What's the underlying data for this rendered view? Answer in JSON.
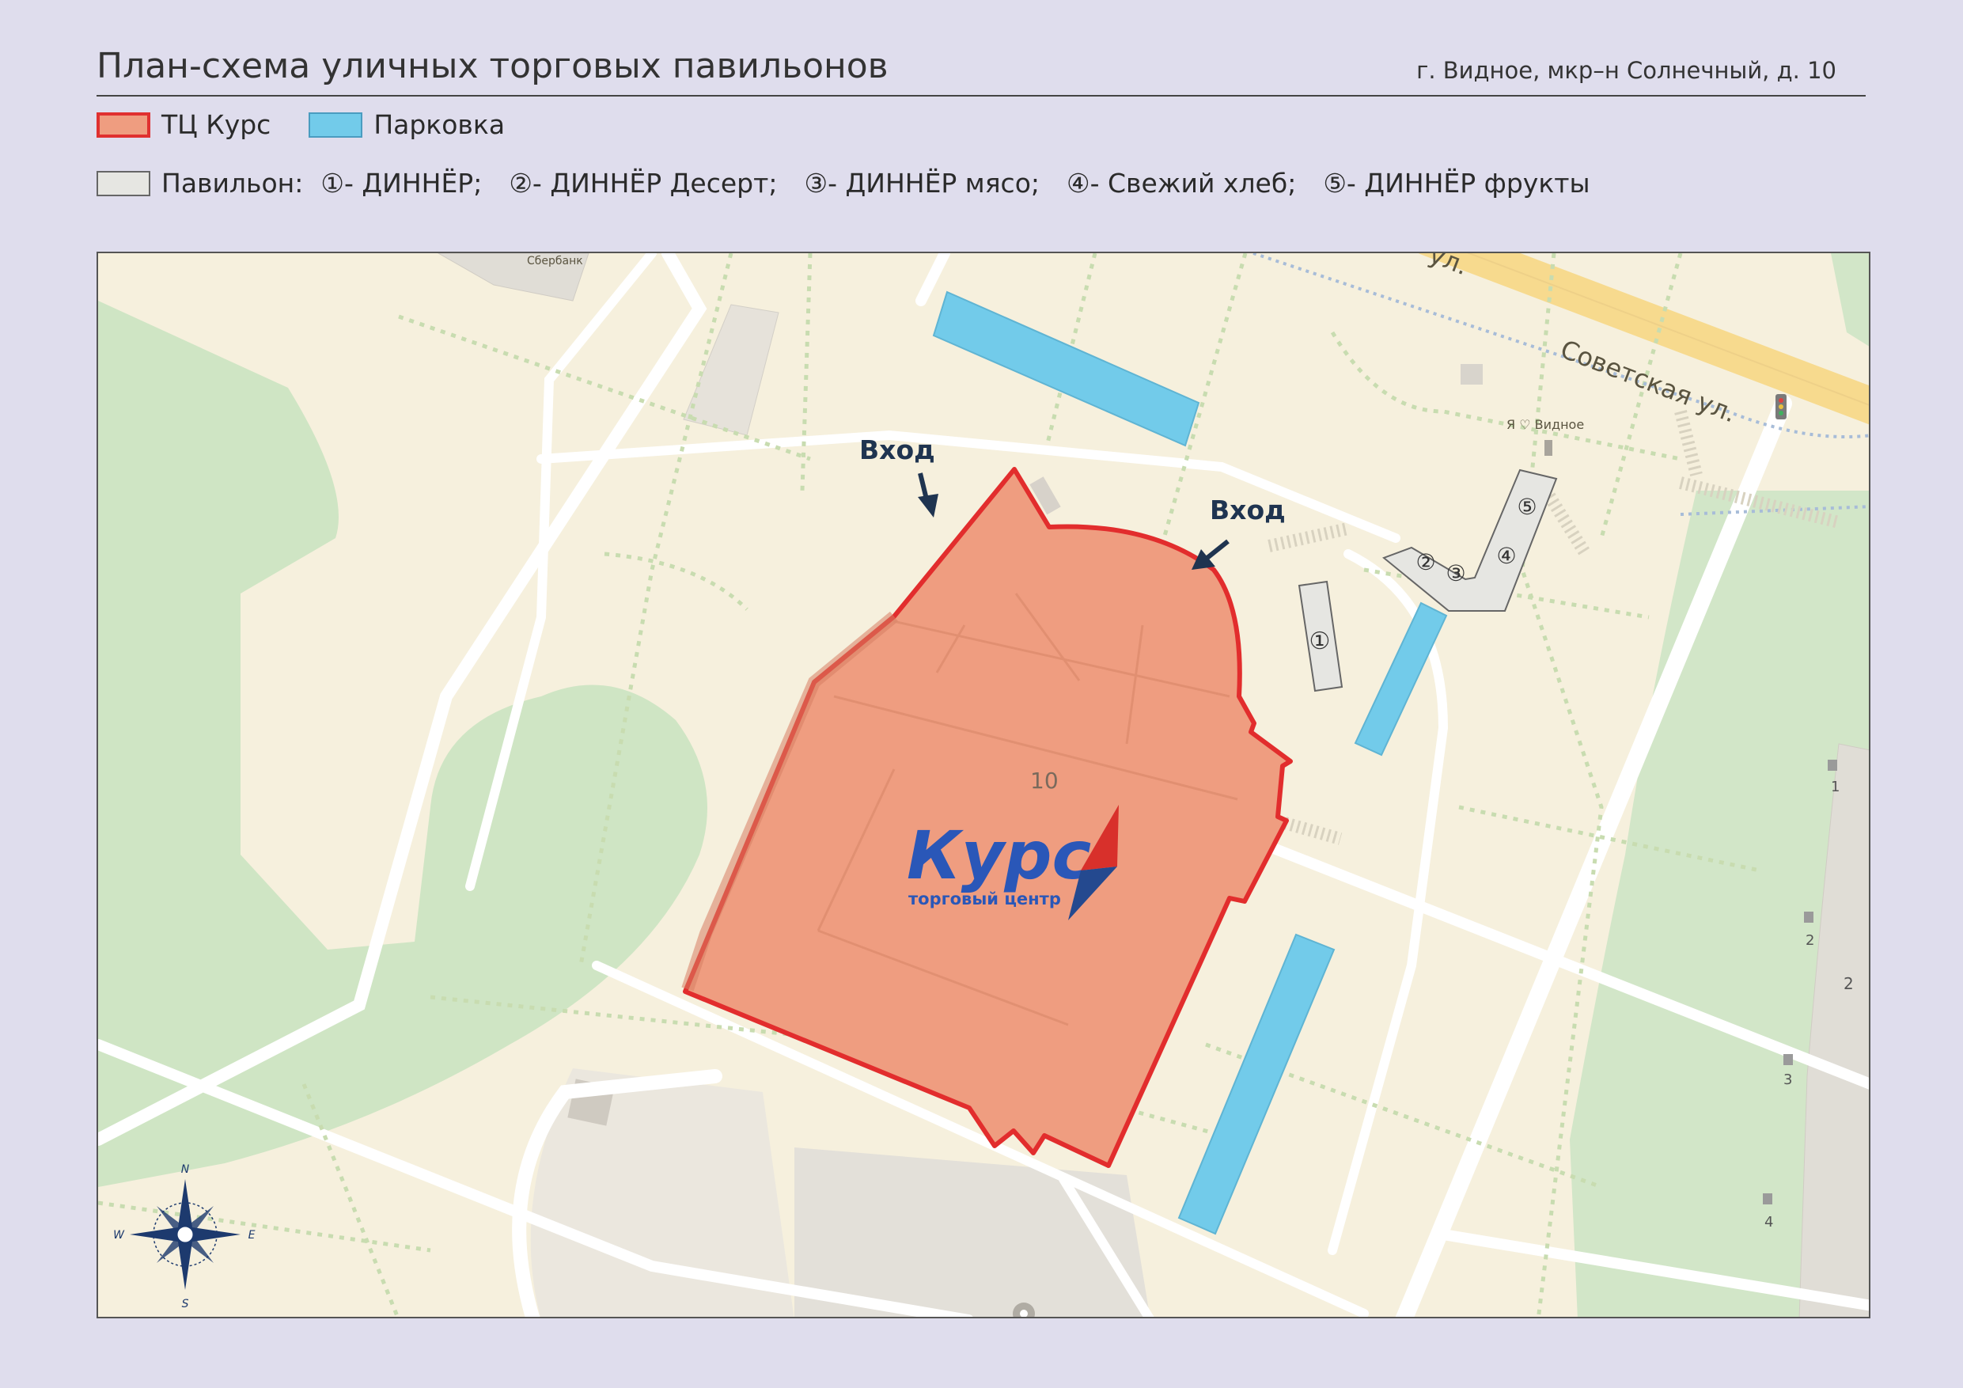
{
  "header": {
    "title": "План-схема уличных торговых павильонов",
    "address": "г. Видное, мкр–н Солнечный, д. 10"
  },
  "legend": {
    "mall_label": "ТЦ Курс",
    "parking_label": "Парковка",
    "pavilion_label": "Павильон:",
    "pavilions": [
      {
        "num": "①",
        "name": "- ДИННЁР;"
      },
      {
        "num": "②",
        "name": "-  ДИННЁР Десерт;"
      },
      {
        "num": "③",
        "name": "- ДИННЁР мясо;"
      },
      {
        "num": "④",
        "name": "- Свежий хлеб;"
      },
      {
        "num": "⑤",
        "name": "-  ДИННЁР фрукты"
      }
    ],
    "colors": {
      "mall_fill": "#ef9d80",
      "mall_border": "#e03030",
      "parking_fill": "#72cbea",
      "pavilion_fill": "#e6e6e2"
    }
  },
  "map": {
    "entrance_label_1": "Вход",
    "entrance_label_2": "Вход",
    "building_number": "10",
    "logo_main": "Курс",
    "logo_sub": "торговый центр",
    "street_label": "Советская ул.",
    "street_fragment": "ул.",
    "poi_sberbank": "Сбербанк",
    "poi_monument": "Я ♡ Видное",
    "pavilion_markers": [
      "①",
      "②",
      "③",
      "④",
      "⑤"
    ],
    "entrance_numbers": [
      "1",
      "2",
      "3",
      "4"
    ],
    "building_number_right": "2",
    "compass": {
      "n": "N",
      "s": "S",
      "e": "E",
      "w": "W"
    }
  }
}
